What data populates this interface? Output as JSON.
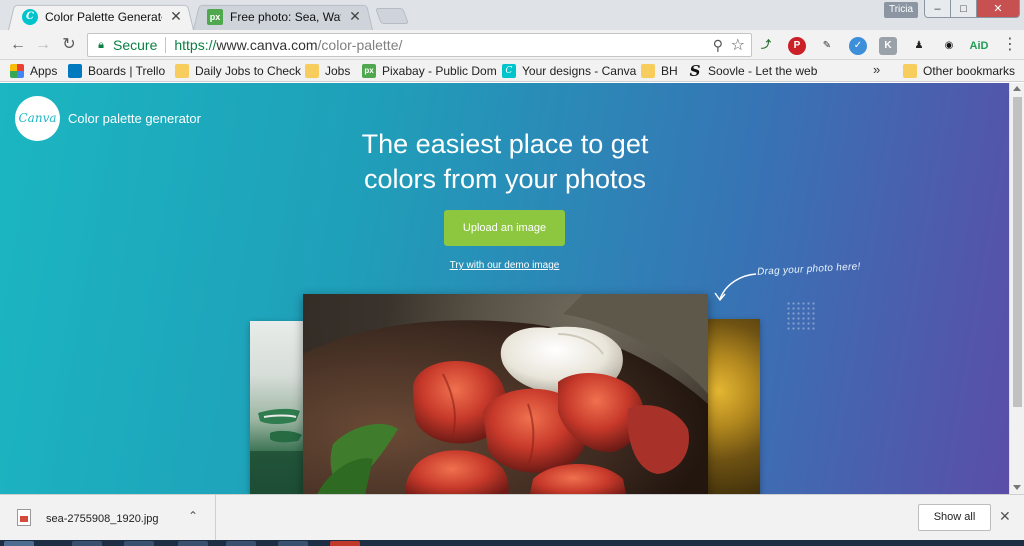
{
  "browser": {
    "tabs": [
      {
        "title": "Color Palette Generator",
        "icon": "canva-icon",
        "active": true
      },
      {
        "title": "Free photo: Sea, Water, W",
        "icon": "pixabay-icon",
        "active": false
      }
    ],
    "profile_name": "Tricia",
    "address": {
      "security_label": "Secure",
      "scheme": "https://",
      "host": "www.canva.com",
      "path": "/color-palette/"
    },
    "bookmarks": [
      {
        "label": "Apps",
        "icon": "apps-icon"
      },
      {
        "label": "Boards | Trello",
        "icon": "trello-icon"
      },
      {
        "label": "Daily Jobs to Check",
        "icon": "folder-icon"
      },
      {
        "label": "Jobs",
        "icon": "folder-icon"
      },
      {
        "label": "Pixabay - Public Dom",
        "icon": "pixabay-icon"
      },
      {
        "label": "Your designs - Canva",
        "icon": "canva-icon"
      },
      {
        "label": "BH",
        "icon": "folder-icon"
      },
      {
        "label": "Soovle - Let the web",
        "icon": "soovle-icon"
      }
    ],
    "overflow_label": "»",
    "other_bookmarks": "Other bookmarks",
    "extensions": [
      "ext-arrow",
      "pinterest-icon",
      "eyedropper-icon",
      "shield-icon",
      "ext-k",
      "ext-person",
      "ext-owl",
      "ext-aid"
    ],
    "extension_labels": {
      "aid": "AiD",
      "k": "K"
    }
  },
  "page": {
    "logo_text": "Canva",
    "brand_title": "Color palette generator",
    "headline_line1": "The easiest place to get",
    "headline_line2": "colors from your photos",
    "upload_label": "Upload an image",
    "demo_label": "Try with our demo image",
    "drag_hint": "Drag your photo here!",
    "colors": {
      "upload": "#8dc63f",
      "gradient_start": "#1bb6c2",
      "gradient_end": "#5a4ea8"
    }
  },
  "downloads": {
    "file_name": "sea-2755908_1920.jpg",
    "show_all_label": "Show all"
  }
}
